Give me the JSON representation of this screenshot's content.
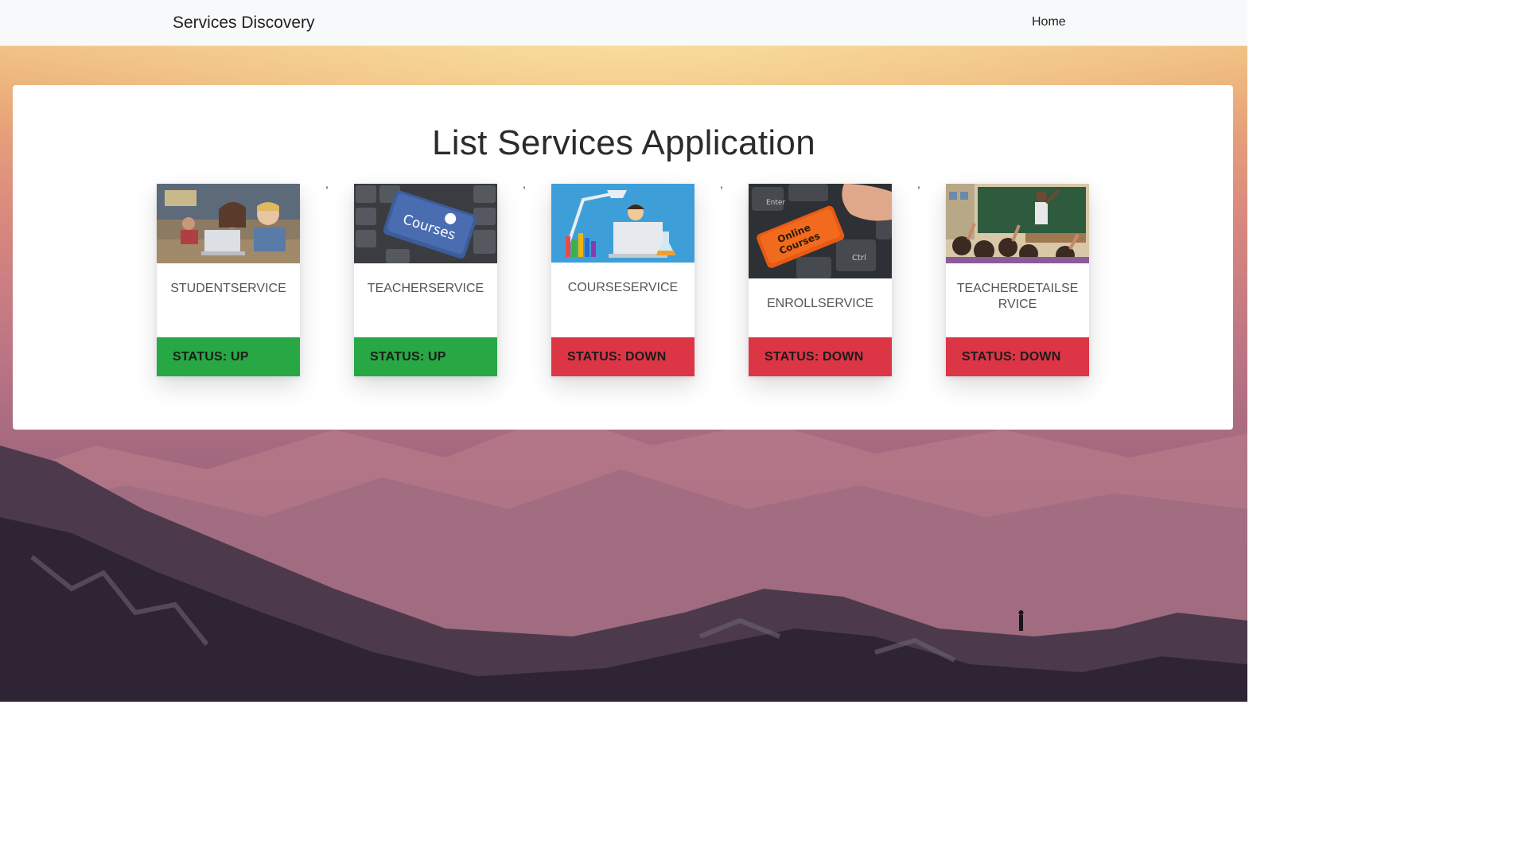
{
  "navbar": {
    "brand": "Services Discovery",
    "home_label": "Home"
  },
  "main": {
    "title": "List Services Application"
  },
  "separator": ",",
  "colors": {
    "status_up": "#28a745",
    "status_down": "#dc3545",
    "navbar_bg": "#f8f9fa"
  },
  "services": [
    {
      "name": "STUDENTSERVICE",
      "status": "STATUS: UP",
      "state": "up",
      "image": "classroom-laptop-photo"
    },
    {
      "name": "TEACHERSERVICE",
      "status": "STATUS: UP",
      "state": "up",
      "image": "courses-keyboard-photo"
    },
    {
      "name": "COURSESERVICE",
      "status": "STATUS: DOWN",
      "state": "down",
      "image": "science-illustration"
    },
    {
      "name": "ENROLLSERVICE",
      "status": "STATUS: DOWN",
      "state": "down",
      "image": "online-courses-key-photo"
    },
    {
      "name": "TEACHERDETAILSERVICE",
      "status": "STATUS: DOWN",
      "state": "down",
      "image": "classroom-teacher-photo"
    }
  ]
}
